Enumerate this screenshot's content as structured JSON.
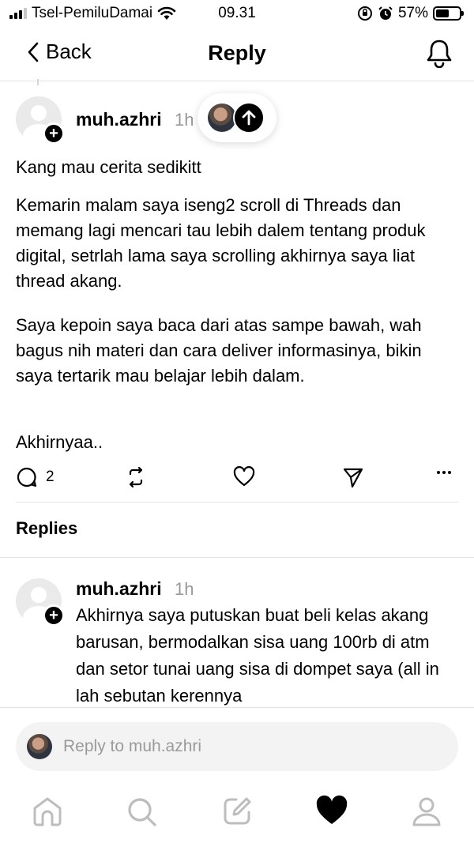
{
  "status_bar": {
    "carrier": "Tsel-PemiluDamai",
    "time": "09.31",
    "battery": "57%",
    "battery_level": 0.57
  },
  "nav": {
    "back_label": "Back",
    "title": "Reply"
  },
  "post": {
    "username": "muh.azhri",
    "time": "1h",
    "paragraphs": [
      "Kang mau cerita sedikitt",
      "Kemarin malam saya iseng2 scroll di Threads dan memang lagi mencari tau lebih dalem tentang produk digital, setrlah lama saya scrolling akhirnya saya liat thread akang.",
      "Saya kepoin saya baca dari atas sampe bawah, wah bagus nih materi dan cara deliver informasinya, bikin saya tertarik mau belajar lebih dalam.",
      "Akhirnyaa.."
    ],
    "reply_count": "2"
  },
  "replies_heading": "Replies",
  "reply": {
    "username": "muh.azhri",
    "time": "1h",
    "text": "Akhirnya saya putuskan buat beli kelas akang barusan, bermodalkan sisa uang 100rb di atm dan setor tunai uang sisa di dompet saya (all in lah sebutan kerennya"
  },
  "composer": {
    "placeholder": "Reply to muh.azhri"
  },
  "tabbar": {
    "items": [
      "home-icon",
      "search-icon",
      "compose-icon",
      "heart-icon",
      "profile-icon"
    ],
    "active": "heart-icon"
  }
}
